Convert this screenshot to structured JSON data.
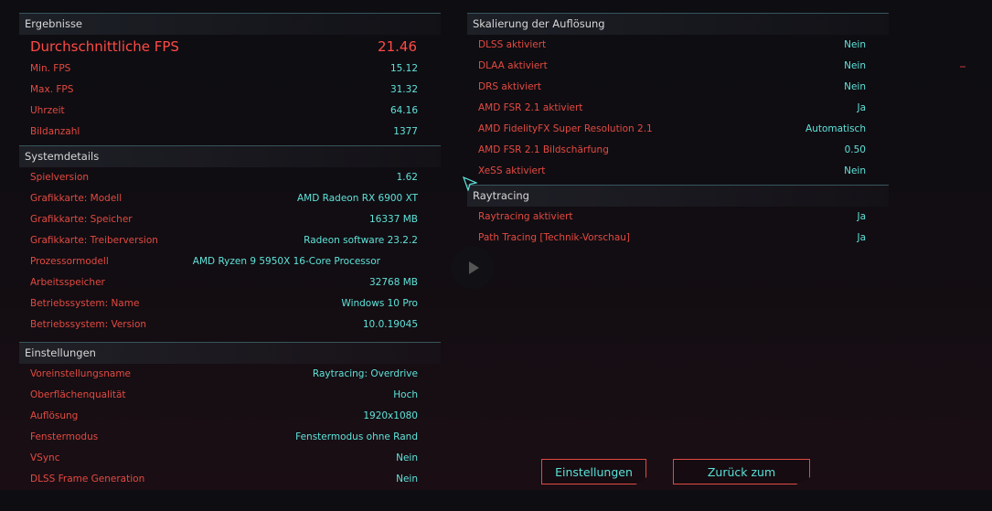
{
  "results": {
    "header": "Ergebnisse",
    "rows": [
      {
        "label": "Durchschnittliche FPS",
        "value": "21.46"
      },
      {
        "label": "Min. FPS",
        "value": "15.12"
      },
      {
        "label": "Max. FPS",
        "value": "31.32"
      },
      {
        "label": "Uhrzeit",
        "value": "64.16"
      },
      {
        "label": "Bildanzahl",
        "value": "1377"
      }
    ]
  },
  "system": {
    "header": "Systemdetails",
    "rows": [
      {
        "label": "Spielversion",
        "value": "1.62"
      },
      {
        "label": "Grafikkarte: Modell",
        "value": "AMD Radeon RX 6900 XT"
      },
      {
        "label": "Grafikkarte: Speicher",
        "value": "16337 MB"
      },
      {
        "label": "Grafikkarte: Treiberversion",
        "value": "Radeon software 23.2.2"
      },
      {
        "label": "Prozessormodell",
        "value": "AMD Ryzen 9 5950X 16-Core Processor"
      },
      {
        "label": "Arbeitsspeicher",
        "value": "32768 MB"
      },
      {
        "label": "Betriebssystem: Name",
        "value": "Windows 10 Pro"
      },
      {
        "label": "Betriebssystem: Version",
        "value": "10.0.19045"
      }
    ]
  },
  "settings": {
    "header": "Einstellungen",
    "rows": [
      {
        "label": "Voreinstellungsname",
        "value": "Raytracing: Overdrive"
      },
      {
        "label": "Oberflächenqualität",
        "value": "Hoch"
      },
      {
        "label": "Auflösung",
        "value": "1920x1080"
      },
      {
        "label": "Fenstermodus",
        "value": "Fenstermodus ohne Rand"
      },
      {
        "label": "VSync",
        "value": "Nein"
      },
      {
        "label": "DLSS Frame Generation",
        "value": "Nein"
      }
    ]
  },
  "scaling": {
    "header": "Skalierung der Auflösung",
    "rows": [
      {
        "label": "DLSS aktiviert",
        "value": "Nein"
      },
      {
        "label": "DLAA aktiviert",
        "value": "Nein"
      },
      {
        "label": "DRS aktiviert",
        "value": "Nein"
      },
      {
        "label": "AMD FSR 2.1 aktiviert",
        "value": "Ja"
      },
      {
        "label": "AMD FidelityFX Super Resolution 2.1",
        "value": "Automatisch"
      },
      {
        "label": "AMD FSR 2.1 Bildschärfung",
        "value": "0.50"
      },
      {
        "label": "XeSS aktiviert",
        "value": "Nein"
      }
    ]
  },
  "raytracing": {
    "header": "Raytracing",
    "rows": [
      {
        "label": "Raytracing aktiviert",
        "value": "Ja"
      },
      {
        "label": "Path Tracing [Technik-Vorschau]",
        "value": "Ja"
      }
    ]
  },
  "buttons": {
    "settings": "Einstellungen",
    "main_menu": "Zurück zum Hauptmenü"
  },
  "colors": {
    "label": "#e34a41",
    "value": "#5fe3da",
    "header_text": "#d7d7d7",
    "divider": "#35555c",
    "button_border": "#e04a44"
  },
  "icons": {
    "play_overlay": "play-icon",
    "cursor": "mouse-cursor-icon"
  }
}
